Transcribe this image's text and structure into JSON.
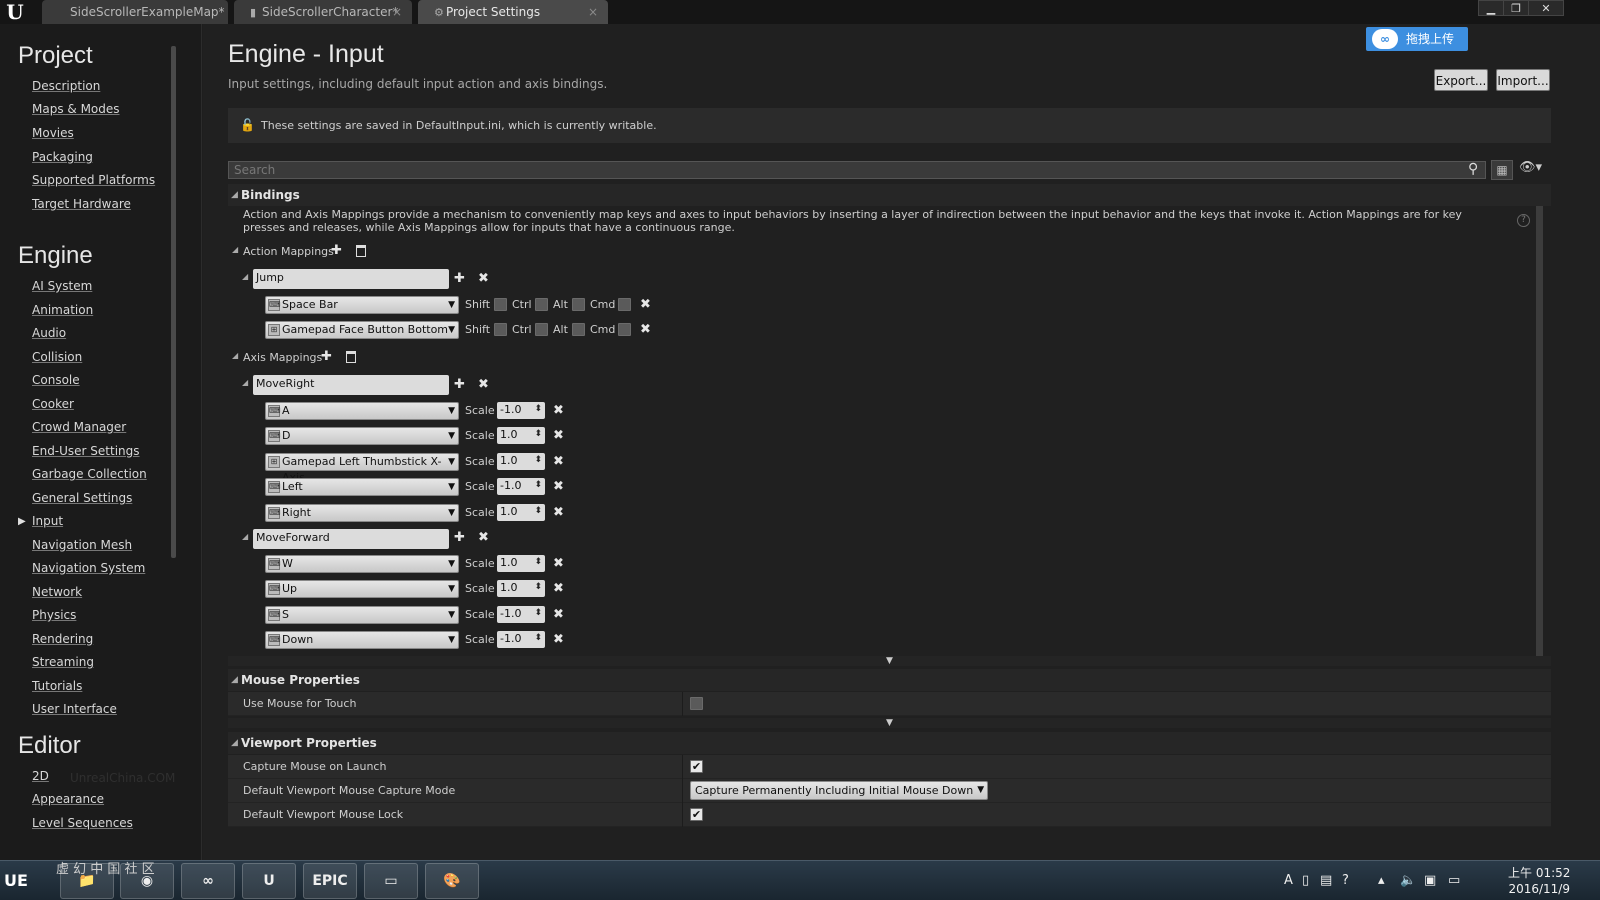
{
  "tabs": [
    {
      "label": "SideScrollerExampleMap*",
      "icon": "map-icon"
    },
    {
      "label": "SideScrollerCharacter*",
      "icon": "blueprint-icon"
    },
    {
      "label": "Project Settings",
      "icon": "gear-icon"
    }
  ],
  "sidebar": {
    "project_title": "Project",
    "project_items": [
      "Description",
      "Maps & Modes",
      "Movies",
      "Packaging",
      "Supported Platforms",
      "Target Hardware"
    ],
    "engine_title": "Engine",
    "engine_items": [
      "AI System",
      "Animation",
      "Audio",
      "Collision",
      "Console",
      "Cooker",
      "Crowd Manager",
      "End-User Settings",
      "Garbage Collection",
      "General Settings",
      "Input",
      "Navigation Mesh",
      "Navigation System",
      "Network",
      "Physics",
      "Rendering",
      "Streaming",
      "Tutorials",
      "User Interface"
    ],
    "selected": "Input",
    "editor_title": "Editor",
    "editor_items": [
      "2D",
      "Appearance",
      "Level Sequences"
    ],
    "watermark": "UnrealChina.COM"
  },
  "header": {
    "title": "Engine - Input",
    "subtitle": "Input settings, including default input action and axis bindings.",
    "upload_label": "拖拽上传",
    "export_label": "Export...",
    "import_label": "Import..."
  },
  "notice": "These settings are saved in DefaultInput.ini, which is currently writable.",
  "search": {
    "placeholder": "Search"
  },
  "bindings": {
    "title": "Bindings",
    "description": "Action and Axis Mappings provide a mechanism to conveniently map keys and axes to input behaviors by inserting a layer of indirection between the input behavior and the keys that invoke it. Action Mappings are for key presses and releases, while Axis Mappings allow for inputs that have a continuous range.",
    "action_label": "Action Mappings",
    "axis_label": "Axis Mappings",
    "modifiers": [
      "Shift",
      "Ctrl",
      "Alt",
      "Cmd"
    ],
    "scale_label": "Scale",
    "actions": [
      {
        "name": "Jump",
        "keys": [
          "Space Bar",
          "Gamepad Face Button Bottom"
        ]
      }
    ],
    "axes": [
      {
        "name": "MoveRight",
        "keys": [
          {
            "key": "A",
            "scale": "-1.0"
          },
          {
            "key": "D",
            "scale": "1.0"
          },
          {
            "key": "Gamepad Left Thumbstick X-Axis",
            "scale": "1.0"
          },
          {
            "key": "Left",
            "scale": "-1.0"
          },
          {
            "key": "Right",
            "scale": "1.0"
          }
        ]
      },
      {
        "name": "MoveForward",
        "keys": [
          {
            "key": "W",
            "scale": "1.0"
          },
          {
            "key": "Up",
            "scale": "1.0"
          },
          {
            "key": "S",
            "scale": "-1.0"
          },
          {
            "key": "Down",
            "scale": "-1.0"
          }
        ]
      }
    ]
  },
  "mouse": {
    "title": "Mouse Properties",
    "use_mouse_for_touch": "Use Mouse for Touch"
  },
  "viewport": {
    "title": "Viewport Properties",
    "capture_on_launch": "Capture Mouse on Launch",
    "capture_mode_label": "Default Viewport Mouse Capture Mode",
    "capture_mode_value": "Capture Permanently Including Initial Mouse Down",
    "mouse_lock": "Default Viewport Mouse Lock"
  },
  "taskbar": {
    "watermark": "虚 幻 中 国 社 区",
    "epic_label": "EPIC",
    "time": "上午 01:52",
    "date": "2016/11/9"
  }
}
